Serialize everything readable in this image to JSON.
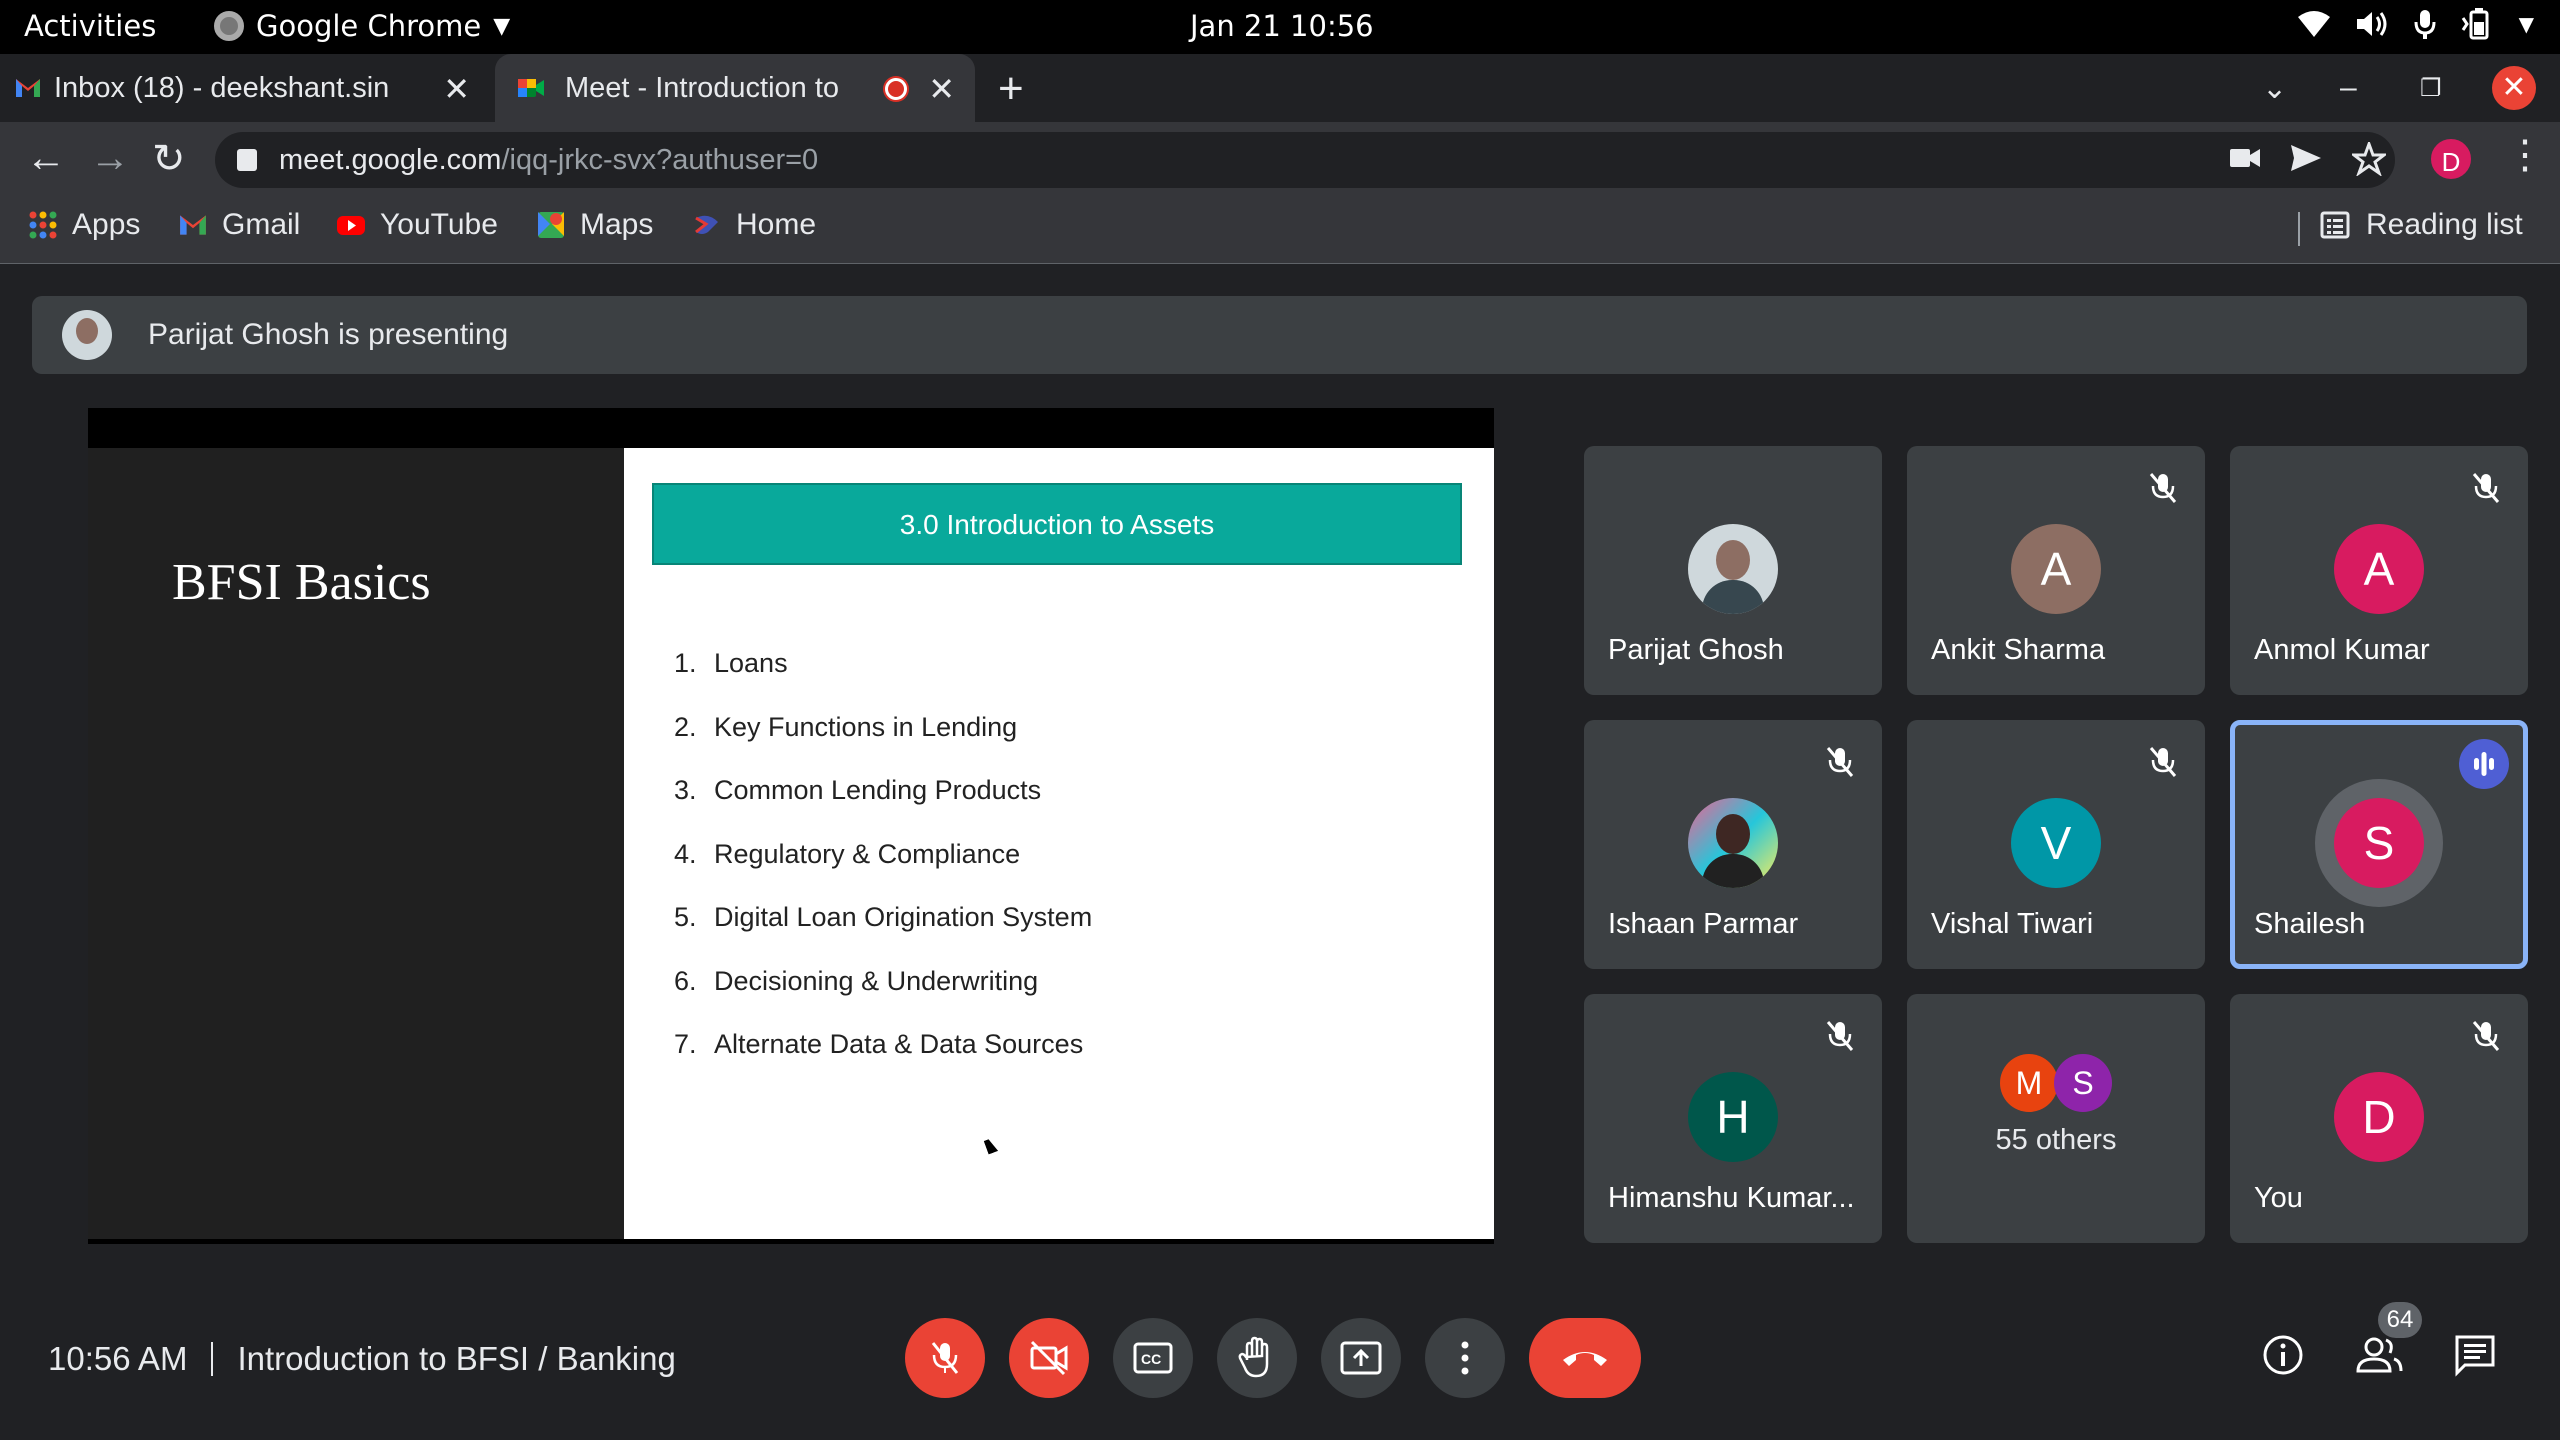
{
  "system_bar": {
    "activities": "Activities",
    "app_name": "Google Chrome",
    "clock": "Jan 21  10:56"
  },
  "tabs": [
    {
      "title": "Inbox (18) - deekshant.sin",
      "icon": "gmail-icon",
      "active": false
    },
    {
      "title": "Meet - Introduction to",
      "icon": "meet-icon",
      "active": true,
      "recording": true
    }
  ],
  "address_bar": {
    "host": "meet.google.com",
    "path": "/iqq-jrkc-svx?authuser=0",
    "profile_initial": "D"
  },
  "bookmarks": {
    "items": [
      {
        "label": "Apps",
        "icon": "apps-grid-icon"
      },
      {
        "label": "Gmail",
        "icon": "gmail-icon"
      },
      {
        "label": "YouTube",
        "icon": "youtube-icon"
      },
      {
        "label": "Maps",
        "icon": "maps-icon"
      },
      {
        "label": "Home",
        "icon": "home-icon"
      }
    ],
    "reading_list": "Reading list"
  },
  "meet": {
    "presenting_banner": "Parijat Ghosh is presenting",
    "slide": {
      "title": "BFSI Basics",
      "banner": "3.0 Introduction to Assets",
      "items": [
        {
          "num": "1.",
          "text": "Loans"
        },
        {
          "num": "2.",
          "text": "Key Functions in Lending"
        },
        {
          "num": "3.",
          "text": "Common Lending Products"
        },
        {
          "num": "4.",
          "text": "Regulatory & Compliance"
        },
        {
          "num": "5.",
          "text": "Digital Loan Origination System"
        },
        {
          "num": "6.",
          "text": "Decisioning & Underwriting"
        },
        {
          "num": "7.",
          "text": "Alternate Data & Data Sources"
        }
      ]
    },
    "participants": [
      {
        "name": "Parijat Ghosh",
        "initial": "",
        "color": "#cfd8dc",
        "muted": false,
        "photo": true
      },
      {
        "name": "Ankit Sharma",
        "initial": "A",
        "color": "#8d6e63",
        "muted": true
      },
      {
        "name": "Anmol Kumar",
        "initial": "A",
        "color": "#d81b60",
        "muted": true
      },
      {
        "name": "Ishaan Parmar",
        "initial": "",
        "color": "#263238",
        "muted": true,
        "photo": true
      },
      {
        "name": "Vishal Tiwari",
        "initial": "V",
        "color": "#0097a7",
        "muted": true
      },
      {
        "name": "Shailesh",
        "initial": "S",
        "color": "#d81b60",
        "muted": false,
        "speaking": true
      },
      {
        "name": "Himanshu Kumar...",
        "initial": "H",
        "color": "#00574b",
        "muted": true
      },
      {
        "name": "You",
        "initial": "D",
        "color": "#d81b60",
        "muted": true
      }
    ],
    "others": {
      "label": "55 others",
      "avatars": [
        {
          "initial": "M",
          "color": "#e8430f"
        },
        {
          "initial": "S",
          "color": "#8e24aa"
        }
      ]
    },
    "footer": {
      "time": "10:56 AM",
      "meeting_title": "Introduction to BFSI / Banking",
      "participant_count": "64"
    }
  }
}
